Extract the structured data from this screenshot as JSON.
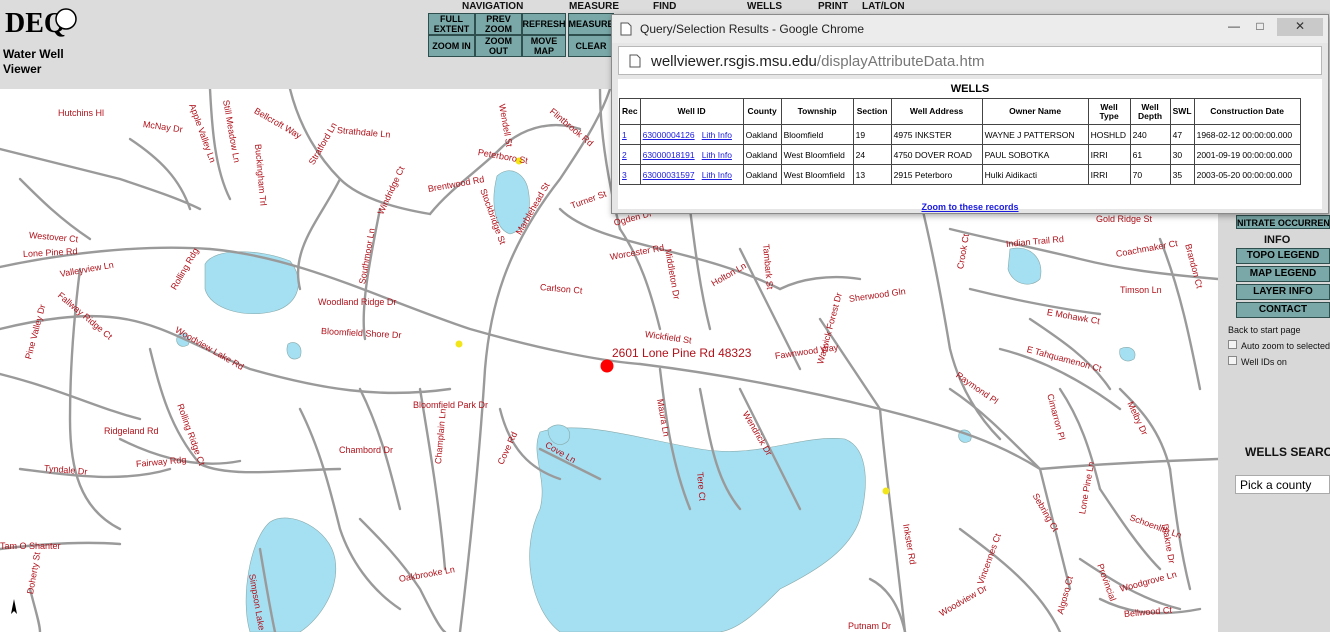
{
  "app": {
    "logo_text": "DEQ",
    "title": "Water Well Viewer"
  },
  "toolbar": {
    "groups": [
      {
        "label": "NAVIGATION"
      },
      {
        "label": "MEASURE"
      },
      {
        "label": "FIND"
      },
      {
        "label": "WELLS"
      },
      {
        "label": "PRINT"
      },
      {
        "label": "LAT/LON"
      }
    ],
    "buttons": {
      "full_extent": "FULL EXTENT",
      "prev_zoom": "PREV ZOOM",
      "refresh": "REFRESH",
      "measure": "MEASURE",
      "zoom_in": "ZOOM IN",
      "zoom_out": "ZOOM OUT",
      "move_map": "MOVE MAP",
      "clear": "CLEAR"
    }
  },
  "popup": {
    "window_title": "Query/Selection Results - Google Chrome",
    "url_host": "wellviewer.rsgis.msu.edu",
    "url_path": "/displayAttributeData.htm",
    "heading": "WELLS",
    "columns": [
      "Rec",
      "Well ID",
      "County",
      "Township",
      "Section",
      "Well Address",
      "Owner Name",
      "Well Type",
      "Well Depth",
      "SWL",
      "Construction Date"
    ],
    "rows": [
      {
        "rec": "1",
        "well_id": "63000004126",
        "lith": "Lith Info",
        "county": "Oakland",
        "township": "Bloomfield",
        "section": "19",
        "address": "4975 INKSTER",
        "owner": "WAYNE J PATTERSON",
        "type": "HOSHLD",
        "depth": "240",
        "swl": "47",
        "date": "1968-02-12 00:00:00.000"
      },
      {
        "rec": "2",
        "well_id": "63000018191",
        "lith": "Lith Info",
        "county": "Oakland",
        "township": "West Bloomfield",
        "section": "24",
        "address": "4750 DOVER ROAD",
        "owner": "PAUL SOBOTKA",
        "type": "IRRI",
        "depth": "61",
        "swl": "30",
        "date": "2001-09-19 00:00:00.000"
      },
      {
        "rec": "3",
        "well_id": "63000031597",
        "lith": "Lith Info",
        "county": "Oakland",
        "township": "West Bloomfield",
        "section": "13",
        "address": "2915 Peterboro",
        "owner": "Hulki Aidikacti",
        "type": "IRRI",
        "depth": "70",
        "swl": "35",
        "date": "2003-05-20 00:00:00.000"
      }
    ],
    "zoom_link": "Zoom to these records"
  },
  "map": {
    "address_label": "2601   Lone Pine Rd  48323",
    "streets": [
      {
        "name": "Hutchins Hl"
      },
      {
        "name": "McNay Dr"
      },
      {
        "name": "Apple Valley Ln"
      },
      {
        "name": "Still Meadow Ln"
      },
      {
        "name": "Buckingham Trl"
      },
      {
        "name": "Bellcroft Way"
      },
      {
        "name": "Strathdale Ln"
      },
      {
        "name": "Wendell St"
      },
      {
        "name": "Flintbrook Rd"
      },
      {
        "name": "Peterboro St"
      },
      {
        "name": "Brentwood Rd"
      },
      {
        "name": "Stratford Ln"
      },
      {
        "name": "Windridge Ct"
      },
      {
        "name": "Stockbridge St"
      },
      {
        "name": "Marblehead St"
      },
      {
        "name": "Turner St"
      },
      {
        "name": "Ogden Dr"
      },
      {
        "name": "Westover Ct"
      },
      {
        "name": "Lone Pine Rd"
      },
      {
        "name": "Valleyview Ln"
      },
      {
        "name": "Rolling Rdg"
      },
      {
        "name": "Woodland Ridge Dr"
      },
      {
        "name": "Bloomfield Shore Dr"
      },
      {
        "name": "Woodview Lake Rd"
      },
      {
        "name": "Pine Valley Dr"
      },
      {
        "name": "Fallway Ridge Ct"
      },
      {
        "name": "Wickfield St"
      },
      {
        "name": "Fawnwood Way"
      },
      {
        "name": "Worcester Rd"
      },
      {
        "name": "Carlson Ct"
      },
      {
        "name": "Sherwood Gln"
      },
      {
        "name": "Bloomfield Park Dr"
      },
      {
        "name": "Ridgeland Rd"
      },
      {
        "name": "Rolling Ridge Ct"
      },
      {
        "name": "Fairway Rdg"
      },
      {
        "name": "Tyndale Dr"
      },
      {
        "name": "Chambord Dr"
      },
      {
        "name": "Champlain Ln"
      },
      {
        "name": "Cove Rd"
      },
      {
        "name": "Cove Ln"
      },
      {
        "name": "Tam O Shanter"
      },
      {
        "name": "Doherty St"
      },
      {
        "name": "Simpson Lake Rd"
      },
      {
        "name": "Oakbrooke Ln"
      },
      {
        "name": "Inkster Rd"
      },
      {
        "name": "Putnam Dr"
      },
      {
        "name": "Woodview Dr"
      },
      {
        "name": "Vincennes Ct"
      },
      {
        "name": "Algoso Ct"
      },
      {
        "name": "Bellwood Ct"
      },
      {
        "name": "Woodgrove Ln"
      },
      {
        "name": "Schoenlith Ln"
      },
      {
        "name": "Lone Pine Ln"
      },
      {
        "name": "Indian Trail Rd"
      },
      {
        "name": "Coachmaker Ct"
      },
      {
        "name": "Timson Ln"
      },
      {
        "name": "E Mohawk Ct"
      },
      {
        "name": "E Tahquamenon Ct"
      },
      {
        "name": "Raymond Pl"
      },
      {
        "name": "Cimarron Pl"
      },
      {
        "name": "Melby Dr"
      },
      {
        "name": "Gold Ridge St"
      },
      {
        "name": "Brandon Ct"
      },
      {
        "name": "Crook Ct"
      },
      {
        "name": "Maura Ln"
      },
      {
        "name": "Tere Ct"
      },
      {
        "name": "Wendrick Dr"
      },
      {
        "name": "Warwick Forest Dr"
      },
      {
        "name": "Holton Ln"
      },
      {
        "name": "Middleton Dr"
      },
      {
        "name": "Tambark St"
      },
      {
        "name": "Southmoor Ln"
      },
      {
        "name": "Sebring Ct"
      },
      {
        "name": "Diakne Dr"
      },
      {
        "name": "Provincial"
      }
    ]
  },
  "right_panel": {
    "nitrate": "NITRATE OCCURRENCE",
    "info_heading": "INFO",
    "buttons": [
      "TOPO LEGEND",
      "MAP LEGEND",
      "LAYER INFO",
      "CONTACT"
    ],
    "back_link": "Back to start page",
    "check_auto_zoom": "Auto zoom to selected",
    "check_well_ids": "Well IDs on",
    "wells_search": "WELLS SEARCH",
    "county_select": "Pick a county"
  },
  "colors": {
    "button": "#7aa8a8",
    "road": "#9a9a9a",
    "water": "#a5dff2",
    "street_label": "#b0121b",
    "selected_well": "#ff0000",
    "well": "#f2e51a"
  }
}
